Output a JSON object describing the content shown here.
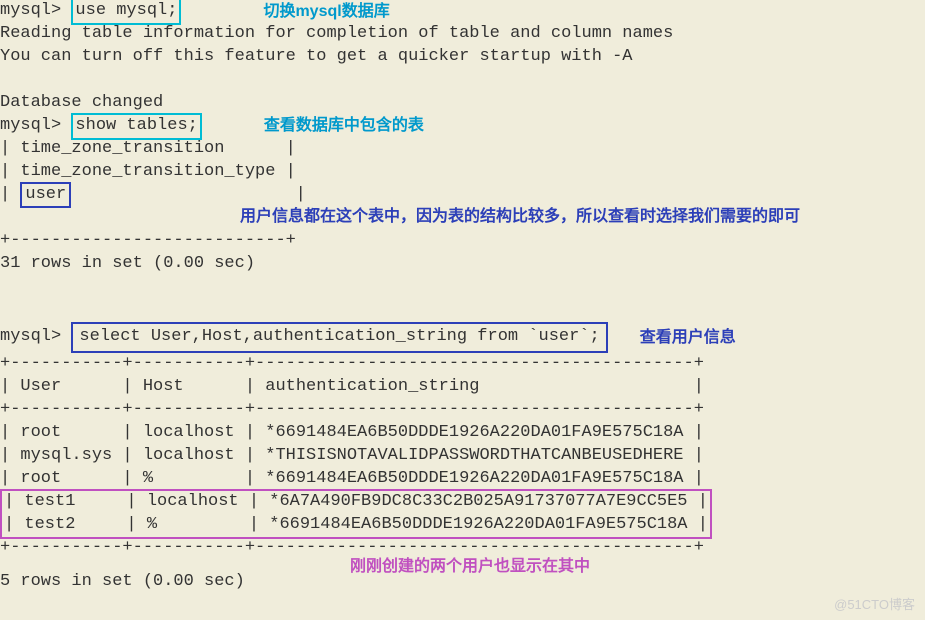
{
  "prompt": "mysql>",
  "cmd1": "use mysql;",
  "anno1": "切换mysql数据库",
  "response1_line1": "Reading table information for completion of table and column names",
  "response1_line2": "You can turn off this feature to get a quicker startup with -A",
  "response1_line3": "Database changed",
  "cmd2": "show tables;",
  "anno2": "查看数据库中包含的表",
  "table_row1": "| time_zone_transition      |",
  "table_row2": "| time_zone_transition_type |",
  "table_row3_pre": "| ",
  "table_row3_boxed": "user",
  "table_row3_post": "                      |",
  "anno3": "用户信息都在这个表中，因为表的结构比较多，所以查看时选择我们需要的即可",
  "table_footer": "+---------------------------+",
  "count1": "31 rows in set (0.00 sec)",
  "cmd3": "select User,Host,authentication_string from `user`;",
  "anno4": "查看用户信息",
  "sep": "+-----------+-----------+-------------------------------------------+",
  "header_row": "| User      | Host      | authentication_string                     |",
  "data_row1": "| root      | localhost | *6691484EA6B50DDDE1926A220DA01FA9E575C18A |",
  "data_row2": "| mysql.sys | localhost | *THISISNOTAVALIDPASSWORDTHATCANBEUSEDHERE |",
  "data_row3": "| root      | %         | *6691484EA6B50DDDE1926A220DA01FA9E575C18A |",
  "data_row4": "| test1     | localhost | *6A7A490FB9DC8C33C2B025A91737077A7E9CC5E5 |",
  "data_row5": "| test2     | %         | *6691484EA6B50DDDE1926A220DA01FA9E575C18A |",
  "anno5": "刚刚创建的两个用户也显示在其中",
  "count2": "5 rows in set (0.00 sec)",
  "watermark": "@51CTO博客"
}
